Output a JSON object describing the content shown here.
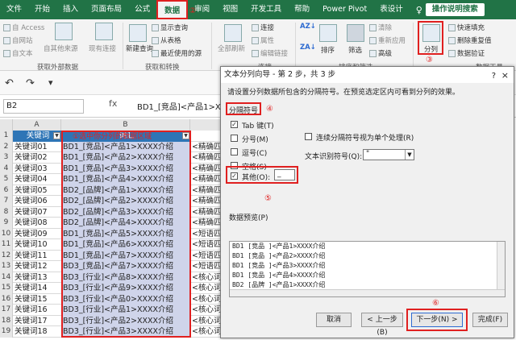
{
  "ribbon_tabs": [
    "文件",
    "开始",
    "插入",
    "页面布局",
    "公式",
    "数据",
    "审阅",
    "视图",
    "开发工具",
    "帮助",
    "Power Pivot",
    "表设计"
  ],
  "active_tab_index": 5,
  "search_tab": "操作说明搜索",
  "annotations": {
    "c2": "②",
    "c3": "③",
    "c4": "④",
    "c5": "⑤",
    "c6": "⑥"
  },
  "ribbon": {
    "from_access": "自 Access",
    "from_web": "自网站",
    "from_text": "自文本",
    "from_other": "自其他来源",
    "existing_conn": "现有连接",
    "get_external": "获取外部数据",
    "new_query": "新建查询",
    "show_queries": "显示查询",
    "from_table": "从表格",
    "recent_sources": "最近使用的源",
    "get_transform": "获取和转换",
    "refresh_all": "全部刷新",
    "connections": "连接",
    "properties": "属性",
    "edit_links": "编辑链接",
    "conn_group": "连接",
    "sort": "排序",
    "filter": "筛选",
    "clear": "清除",
    "reapply": "重新应用",
    "advanced": "高级",
    "sort_filter": "排序和筛选",
    "text_to_columns": "分列",
    "flash_fill": "快速填充",
    "remove_dup": "删除重复值",
    "data_validation": "数据验证",
    "data_tools": "数据工具"
  },
  "name_box": "B2",
  "fx": "fx",
  "formula": "BD1_[竞品]<产品1>XXXX介绍",
  "col_headers": [
    "A",
    "B"
  ],
  "header_note": "①选中你分列的数据区域",
  "rows": [
    {
      "n": "1",
      "a": "关键词",
      "b": "词汇",
      "c": ""
    },
    {
      "n": "2",
      "a": "关键词01",
      "b": "BD1_[竞品]<产品1>XXXX介绍",
      "c": "<精确匹"
    },
    {
      "n": "3",
      "a": "关键词02",
      "b": "BD1_[竞品]<产品2>XXXX介绍",
      "c": "<精确匹"
    },
    {
      "n": "4",
      "a": "关键词03",
      "b": "BD1_[竞品]<产品3>XXXX介绍",
      "c": "<精确匹"
    },
    {
      "n": "5",
      "a": "关键词04",
      "b": "BD1_[竞品]<产品4>XXXX介绍",
      "c": "<精确匹"
    },
    {
      "n": "6",
      "a": "关键词05",
      "b": "BD2_[品牌]<产品1>XXXX介绍",
      "c": "<精确匹"
    },
    {
      "n": "7",
      "a": "关键词06",
      "b": "BD2_[品牌]<产品2>XXXX介绍",
      "c": "<精确匹"
    },
    {
      "n": "8",
      "a": "关键词07",
      "b": "BD2_[品牌]<产品3>XXXX介绍",
      "c": "<精确匹"
    },
    {
      "n": "9",
      "a": "关键词08",
      "b": "BD2_[品牌]<产品4>XXXX介绍",
      "c": "<精确匹"
    },
    {
      "n": "10",
      "a": "关键词09",
      "b": "BD1_[竞品]<产品5>XXXX介绍",
      "c": "<短语匹"
    },
    {
      "n": "11",
      "a": "关键词10",
      "b": "BD1_[竞品]<产品6>XXXX介绍",
      "c": "<短语匹"
    },
    {
      "n": "12",
      "a": "关键词11",
      "b": "BD1_[竞品]<产品7>XXXX介绍",
      "c": "<短语匹"
    },
    {
      "n": "13",
      "a": "关键词12",
      "b": "BD3_[竞品]<产品7>XXXX介绍",
      "c": "<短语匹"
    },
    {
      "n": "14",
      "a": "关键词13",
      "b": "BD3_[行业]<产品8>XXXX介绍",
      "c": "<核心词"
    },
    {
      "n": "15",
      "a": "关键词14",
      "b": "BD3_[行业]<产品9>XXXX介绍",
      "c": "<核心词"
    },
    {
      "n": "16",
      "a": "关键词15",
      "b": "BD3_[行业]<产品0>XXXX介绍",
      "c": "<核心词"
    },
    {
      "n": "17",
      "a": "关键词16",
      "b": "BD3_[行业]<产品1>XXXX介绍",
      "c": "<核心词"
    },
    {
      "n": "18",
      "a": "关键词17",
      "b": "BD3_[行业]<产品2>XXXX介绍",
      "c": "<核心词"
    },
    {
      "n": "19",
      "a": "关键词18",
      "b": "BD3_[行业]<产品3>XXXX介绍",
      "c": "<核心词"
    }
  ],
  "dialog": {
    "title": "文本分列向导 - 第 2 步，共 3 步",
    "help": "?",
    "close": "×",
    "desc": "请设置分列数据所包含的分隔符号。在预览选定区内可看到分列的效果。",
    "delim_group": "分隔符号",
    "tab": "Tab 键(T)",
    "semicolon": "分号(M)",
    "comma": "逗号(C)",
    "space": "空格(S)",
    "other": "其他(O):",
    "other_value": "_",
    "consecutive": "连续分隔符号视为单个处理(R)",
    "qualifier_label": "文本识别符号(Q):",
    "qualifier_value": "\"",
    "preview_label": "数据预览(P)",
    "preview": [
      "BD1  [竞品 ]<产品1>XXXX介绍",
      "BD1  [竞品 ]<产品2>XXXX介绍",
      "BD1  [竞品 ]<产品3>XXXX介绍",
      "BD1  [竞品 ]<产品4>XXXX介绍",
      "BD2  [品牌 ]<产品1>XXXX介绍"
    ],
    "btn_cancel": "取消",
    "btn_back": "< 上一步(B)",
    "btn_next": "下一步(N) >",
    "btn_finish": "完成(F)"
  }
}
